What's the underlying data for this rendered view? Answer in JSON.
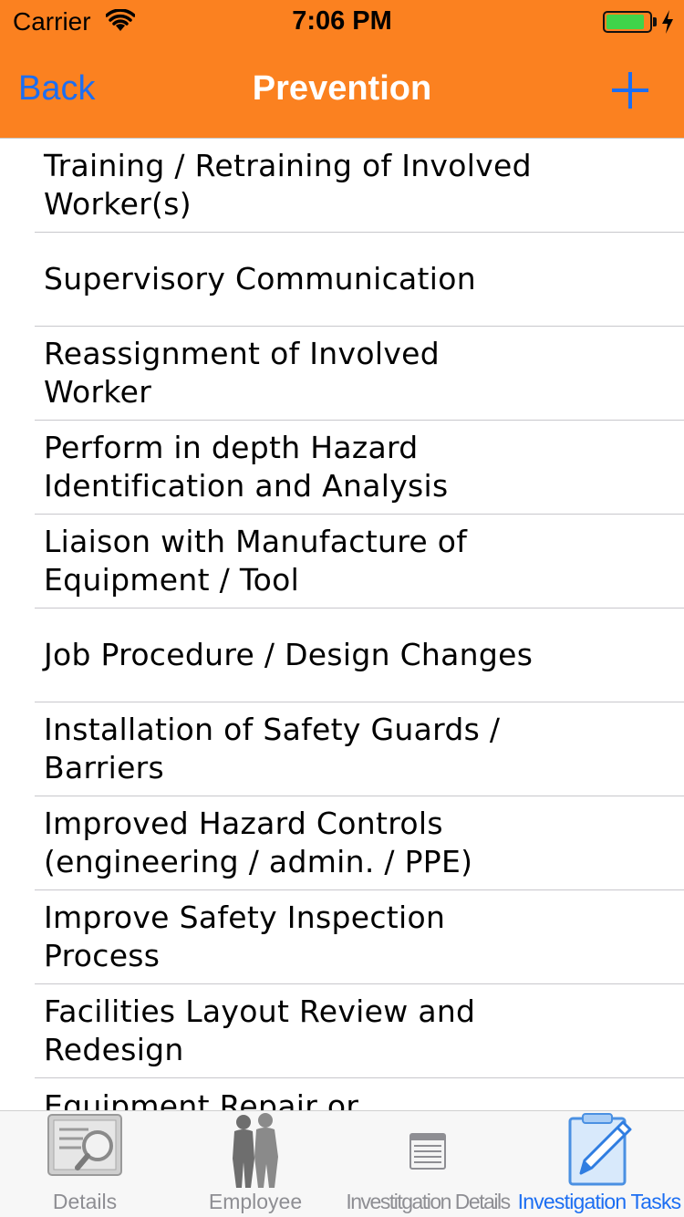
{
  "status": {
    "carrier": "Carrier",
    "time": "7:06 PM",
    "battery_level": 0.9,
    "wifi_icon": "wifi-icon",
    "battery_icon": "battery-charging-icon"
  },
  "nav": {
    "back_label": "Back",
    "title": "Prevention",
    "add_icon": "plus-icon",
    "background": "#fb8120",
    "tint": "#1c6ef2"
  },
  "list": {
    "items": [
      {
        "label": "Training / Retraining of Involved Worker(s)"
      },
      {
        "label": "Supervisory Communication"
      },
      {
        "label": "Reassignment of Involved Worker"
      },
      {
        "label": "Perform in depth Hazard Identification and Analysis"
      },
      {
        "label": "Liaison with Manufacture of Equipment / Tool"
      },
      {
        "label": "Job Procedure / Design Changes"
      },
      {
        "label": "Installation of Safety Guards / Barriers"
      },
      {
        "label": "Improved Hazard Controls (engineering / admin. / PPE)"
      },
      {
        "label": "Improve Safety Inspection Process"
      },
      {
        "label": "Facilities Layout Review and Redesign"
      },
      {
        "label": "Equipment Repair or"
      }
    ]
  },
  "tabbar": {
    "tabs": [
      {
        "label": "Details",
        "icon": "details-magnifier-icon",
        "active": false
      },
      {
        "label": "Employee",
        "icon": "employee-people-icon",
        "active": false
      },
      {
        "label": "Investitgation Details",
        "icon": "document-lines-icon",
        "active": false
      },
      {
        "label": "Investigation Tasks",
        "icon": "clipboard-pencil-icon",
        "active": true
      }
    ]
  }
}
